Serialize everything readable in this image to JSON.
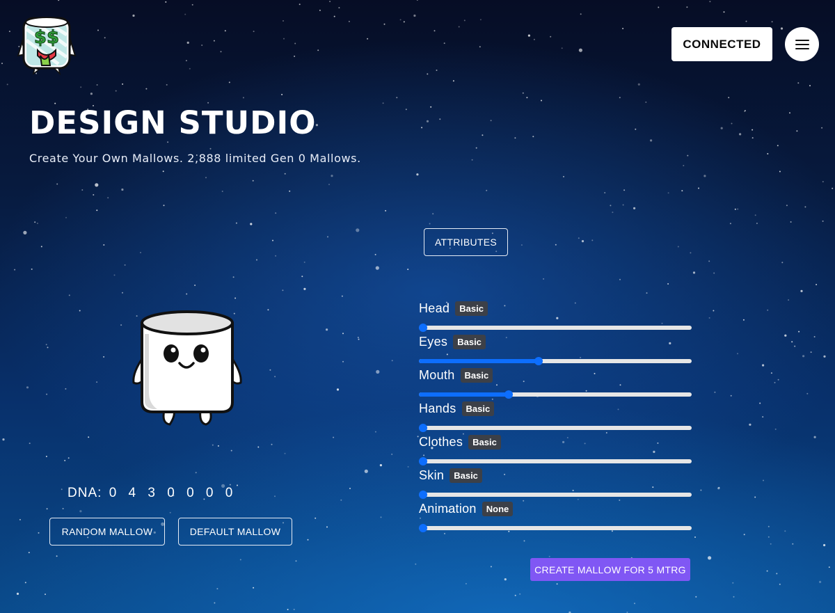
{
  "header": {
    "logo_text": "$$",
    "connected_label": "CONNECTED",
    "menu_icon": "hamburger-menu-icon"
  },
  "page": {
    "title": "DESIGN STUDIO",
    "subtitle": "Create Your Own Mallows. 2,888 limited Gen 0 Mallows."
  },
  "preview": {
    "dna_label": "DNA:",
    "dna_value": "0430000",
    "random_label": "RANDOM MALLOW",
    "default_label": "DEFAULT MALLOW"
  },
  "attributes": {
    "button_label": "ATTRIBUTES",
    "items": [
      {
        "name": "Head",
        "badge": "Basic",
        "level": 0.0
      },
      {
        "name": "Eyes",
        "badge": "Basic",
        "level": 0.44
      },
      {
        "name": "Mouth",
        "badge": "Basic",
        "level": 0.33
      },
      {
        "name": "Hands",
        "badge": "Basic",
        "level": 0.0
      },
      {
        "name": "Clothes",
        "badge": "Basic",
        "level": 0.0
      },
      {
        "name": "Skin",
        "badge": "Basic",
        "level": 0.0
      },
      {
        "name": "Animation",
        "badge": "None",
        "level": 0.0
      }
    ]
  },
  "actions": {
    "create_label": "CREATE MALLOW FOR 5 MTRG"
  },
  "colors": {
    "accent": "#0d6efd",
    "create_button": "#8057f4",
    "badge_bg": "#3c4048"
  }
}
